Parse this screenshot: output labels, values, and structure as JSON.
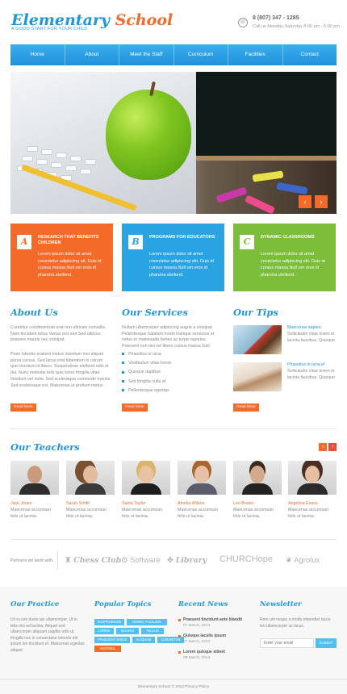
{
  "header": {
    "logo_part1": "Elementary",
    "logo_part2": "School",
    "tagline": "A GOOD START FOR YOUR CHILD",
    "phone": "8 (807) 347 - 1285",
    "hours": "Call us Monday-Saturday 8:00 am - 6:00 pm"
  },
  "nav": [
    "Home",
    "About",
    "Meet the Staff",
    "Curriculum",
    "Facilities",
    "Contact"
  ],
  "slider": {
    "prev": "‹",
    "next": "›"
  },
  "features": [
    {
      "letter": "A",
      "title": "RESEARCH THAT BENEFITS CHILDREN",
      "text": "Lorem ipsum dolor sit amet cocectetur adipiscing elt. Duis id cursus massa.Null um eros id pharetra eleifend.",
      "color": "#f36a29"
    },
    {
      "letter": "B",
      "title": "PROGRAMS FOR EDUCATORS",
      "text": "Lorem ipsum dolor sit amet cocectetur adipiscing elit. Duis id cursus massa.Null um eros id pharetra eleifend.",
      "color": "#2aa3e3"
    },
    {
      "letter": "C",
      "title": "DYNAMIC CLASSROOMS",
      "text": "Lorem ipsum dolor sit amet cocectetur adipiscing elit. Duis id cursus massa.Null um eros id pharetra eleifend.",
      "color": "#7cbd3a"
    }
  ],
  "about": {
    "title": "About Us",
    "p1": "Curabitur condimentum erat non ultricies convallis. Nam tincidunt tellus Varius orci sed Sed ultrices posuere mauris nec volutpat.",
    "p2": "Proin lobortis eratsed metus interdum mei aliquet purus cursus. Sed lacus erat bibendum in rutrum quis tincidunt id libero. Suspendisse eleifend odio et dui. Nunc molestie felis quis tortor fringilla vitae tincidunt vel nulla. Sed scelerisque commodo mauris. Sed scelerisque est. Maecenas ut pretium metus.",
    "button": "Read More"
  },
  "services": {
    "title": "Our Services",
    "p": "Nullam ullamcorper adipiscing augue a volutpat. Pellentesque habitant morbi tristique senectus et netus et malesuada fames ac turpis egestas. Praesent non nisi vel libero cursus massa fusil.",
    "items": [
      "Phasellus in urna",
      "Vestibulum vitae lorem",
      "Quisque dapibus",
      "Sed fringilla nulla at",
      "Pellentesque egestas"
    ],
    "button": "Read More"
  },
  "tips": {
    "title": "Our Tips",
    "items": [
      {
        "title": "Maecenas sapien",
        "text": "Sollicitudin vitae lorem et lacinia faucibus. Quisque"
      },
      {
        "title": "Phasellus in urna el",
        "text": "Sollicitudin vitae lorem et lacinia faucibus. Quisque"
      }
    ],
    "button": "Read More"
  },
  "teachers": {
    "title": "Our Teachers",
    "people": [
      {
        "name": "Jack Jones",
        "desc": "Maecenas accumsan felis ut lacinia."
      },
      {
        "name": "Sarah Smith",
        "desc": "Maecenas accumsan felis ut lacinia."
      },
      {
        "name": "Sarita Taylor",
        "desc": "Maecenas accumsan felis ut lacinia."
      },
      {
        "name": "Amelia Wilson",
        "desc": "Maecenas accumsan felis ut lacinia."
      },
      {
        "name": "Leo Brown",
        "desc": "Maecenas accumsan felis ut lacinia."
      },
      {
        "name": "Angelina Evans",
        "desc": "Maecenas accumsan felis ut lacinia."
      }
    ]
  },
  "partners": {
    "label": "Partners we work with:",
    "names": [
      "Chess Club",
      "Software",
      "Library",
      "CHURCHope",
      "Agrolux"
    ]
  },
  "footer": {
    "practice": {
      "title": "Our Practice",
      "text": "Ut nu ism dueis qui ullamcorper. Ut in felis nisi ud lacinia. Aliquet sed ullamcorper aliquam sagittis odio ut fringilla nec in consectetur lobortis elit ipsum leo tincidunt et. Maecenas egestas aliquet"
    },
    "topics": {
      "title": "Popular Topics",
      "tags": [
        "SUSPENDISSE",
        "DONEC FACILISIS",
        "LOREM",
        "MAURIS",
        "TELLUS",
        "PRAESENT NISUS",
        "ALIQUAM",
        "CURABITUR",
        "VESTIBUL"
      ]
    },
    "news": {
      "title": "Recent News",
      "items": [
        {
          "title": "Praesent tincidunt ante blandit",
          "date": "07 March, 2013"
        },
        {
          "title": "Quisque iaculis ipsum",
          "date": "07 March, 2013"
        },
        {
          "title": "Lorem quisque sitmet",
          "date": "09 March, 2013"
        }
      ]
    },
    "newsletter": {
      "title": "Newsletter",
      "text": "Rem um neque a mollis imperdiet lacus leo ullamcorper ac lacus.",
      "placeholder": "Enter your email",
      "button": "SUBMIT"
    },
    "copyright": "Elementary School © 2013 Privacy Policy"
  }
}
